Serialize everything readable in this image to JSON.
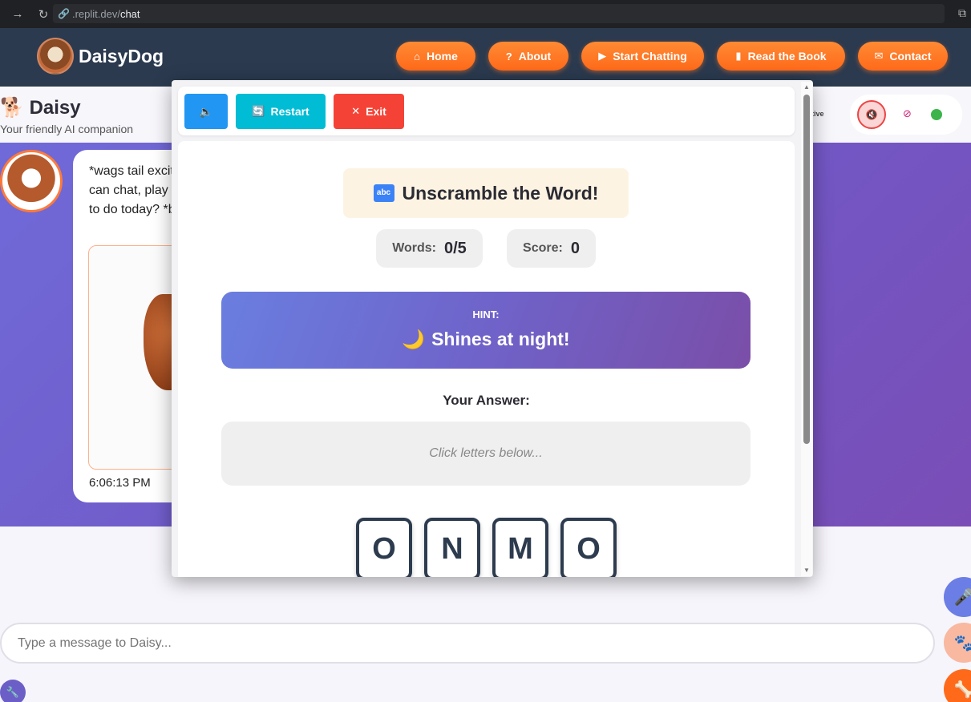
{
  "browser": {
    "url_host": ".replit.dev/",
    "url_path": "chat"
  },
  "header": {
    "logo_text": "DaisyDog",
    "nav": [
      {
        "label": "Home",
        "icon": "home-icon"
      },
      {
        "label": "About",
        "icon": "question-circle-icon"
      },
      {
        "label": "Start Chatting",
        "icon": "play-icon"
      },
      {
        "label": "Read the Book",
        "icon": "book-icon"
      },
      {
        "label": "Contact",
        "icon": "envelope-icon"
      }
    ],
    "accent_color": "#ff7a2a"
  },
  "chat": {
    "name": "Daisy",
    "name_emoji": "🐕",
    "subtitle": "Your friendly AI companion",
    "status_text": "tive",
    "message_text": "*wags tail excit\ncan chat, play\nto do today? *b",
    "message_time": "6:06:13 PM",
    "input_placeholder": "Type a message to Daisy..."
  },
  "game": {
    "toolbar": {
      "sound_label": "🔈",
      "restart_label": "Restart",
      "exit_label": "Exit"
    },
    "title": "Unscramble the Word!",
    "title_icon": "abc",
    "words_label": "Words:",
    "words_value": "0/5",
    "score_label": "Score:",
    "score_value": "0",
    "hint_label": "HINT:",
    "hint_icon": "🌙",
    "hint_text": "Shines at night!",
    "answer_label": "Your Answer:",
    "answer_placeholder": "Click letters below...",
    "letters": [
      "O",
      "N",
      "M",
      "O"
    ]
  }
}
